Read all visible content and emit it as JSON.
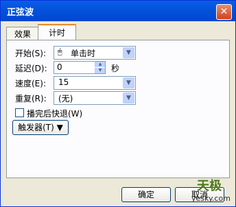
{
  "window": {
    "title": "正弦波",
    "close_glyph": "✕"
  },
  "tabs": [
    {
      "label": "效果"
    },
    {
      "label": "计时"
    }
  ],
  "form": {
    "start_label": "开始(S):",
    "start_value": "单击时",
    "delay_label": "延迟(D):",
    "delay_value": "0",
    "delay_unit": "秒",
    "speed_label": "速度(E):",
    "speed_value": "15",
    "repeat_label": "重复(R):",
    "repeat_value": "(无)",
    "rewind_label": "播完后快退(W)",
    "rewind_checked": false,
    "trigger_label": "触发器(T) ▼"
  },
  "buttons": {
    "ok": "确定",
    "cancel": "取消"
  },
  "watermark": {
    "brand": "天极",
    "url": "yesky.com"
  },
  "icons": {
    "close": "close-icon",
    "mouse": "mouse-icon",
    "dropdown": "chevron-down-icon",
    "spin_up": "spin-up-icon",
    "spin_down": "spin-down-icon"
  },
  "colors": {
    "titlebar": "#0352db",
    "window_bg": "#ece9d8",
    "panel_bg": "#fcfcfe",
    "tab_accent": "#e68b2c"
  }
}
